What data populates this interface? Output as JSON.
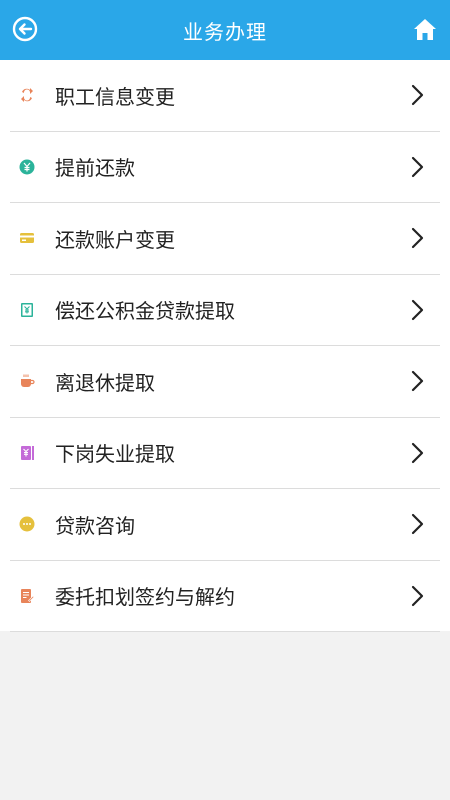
{
  "header": {
    "title": "业务办理"
  },
  "colors": {
    "header_bg": "#2aa7e8",
    "page_bg": "#f2f2f2"
  },
  "items": [
    {
      "label": "职工信息变更",
      "icon": "person-swap-icon",
      "color": "#e8845a"
    },
    {
      "label": "提前还款",
      "icon": "yuan-coin-icon",
      "color": "#2bb39a"
    },
    {
      "label": "还款账户变更",
      "icon": "card-icon",
      "color": "#e5c03c"
    },
    {
      "label": "偿还公积金贷款提取",
      "icon": "yuan-receipt-icon",
      "color": "#2bb39a"
    },
    {
      "label": "离退休提取",
      "icon": "cup-icon",
      "color": "#e8845a"
    },
    {
      "label": "下岗失业提取",
      "icon": "yuan-booklet-icon",
      "color": "#c46ad8"
    },
    {
      "label": "贷款咨询",
      "icon": "chat-bubble-icon",
      "color": "#e5c03c"
    },
    {
      "label": "委托扣划签约与解约",
      "icon": "document-edit-icon",
      "color": "#e8845a"
    }
  ]
}
